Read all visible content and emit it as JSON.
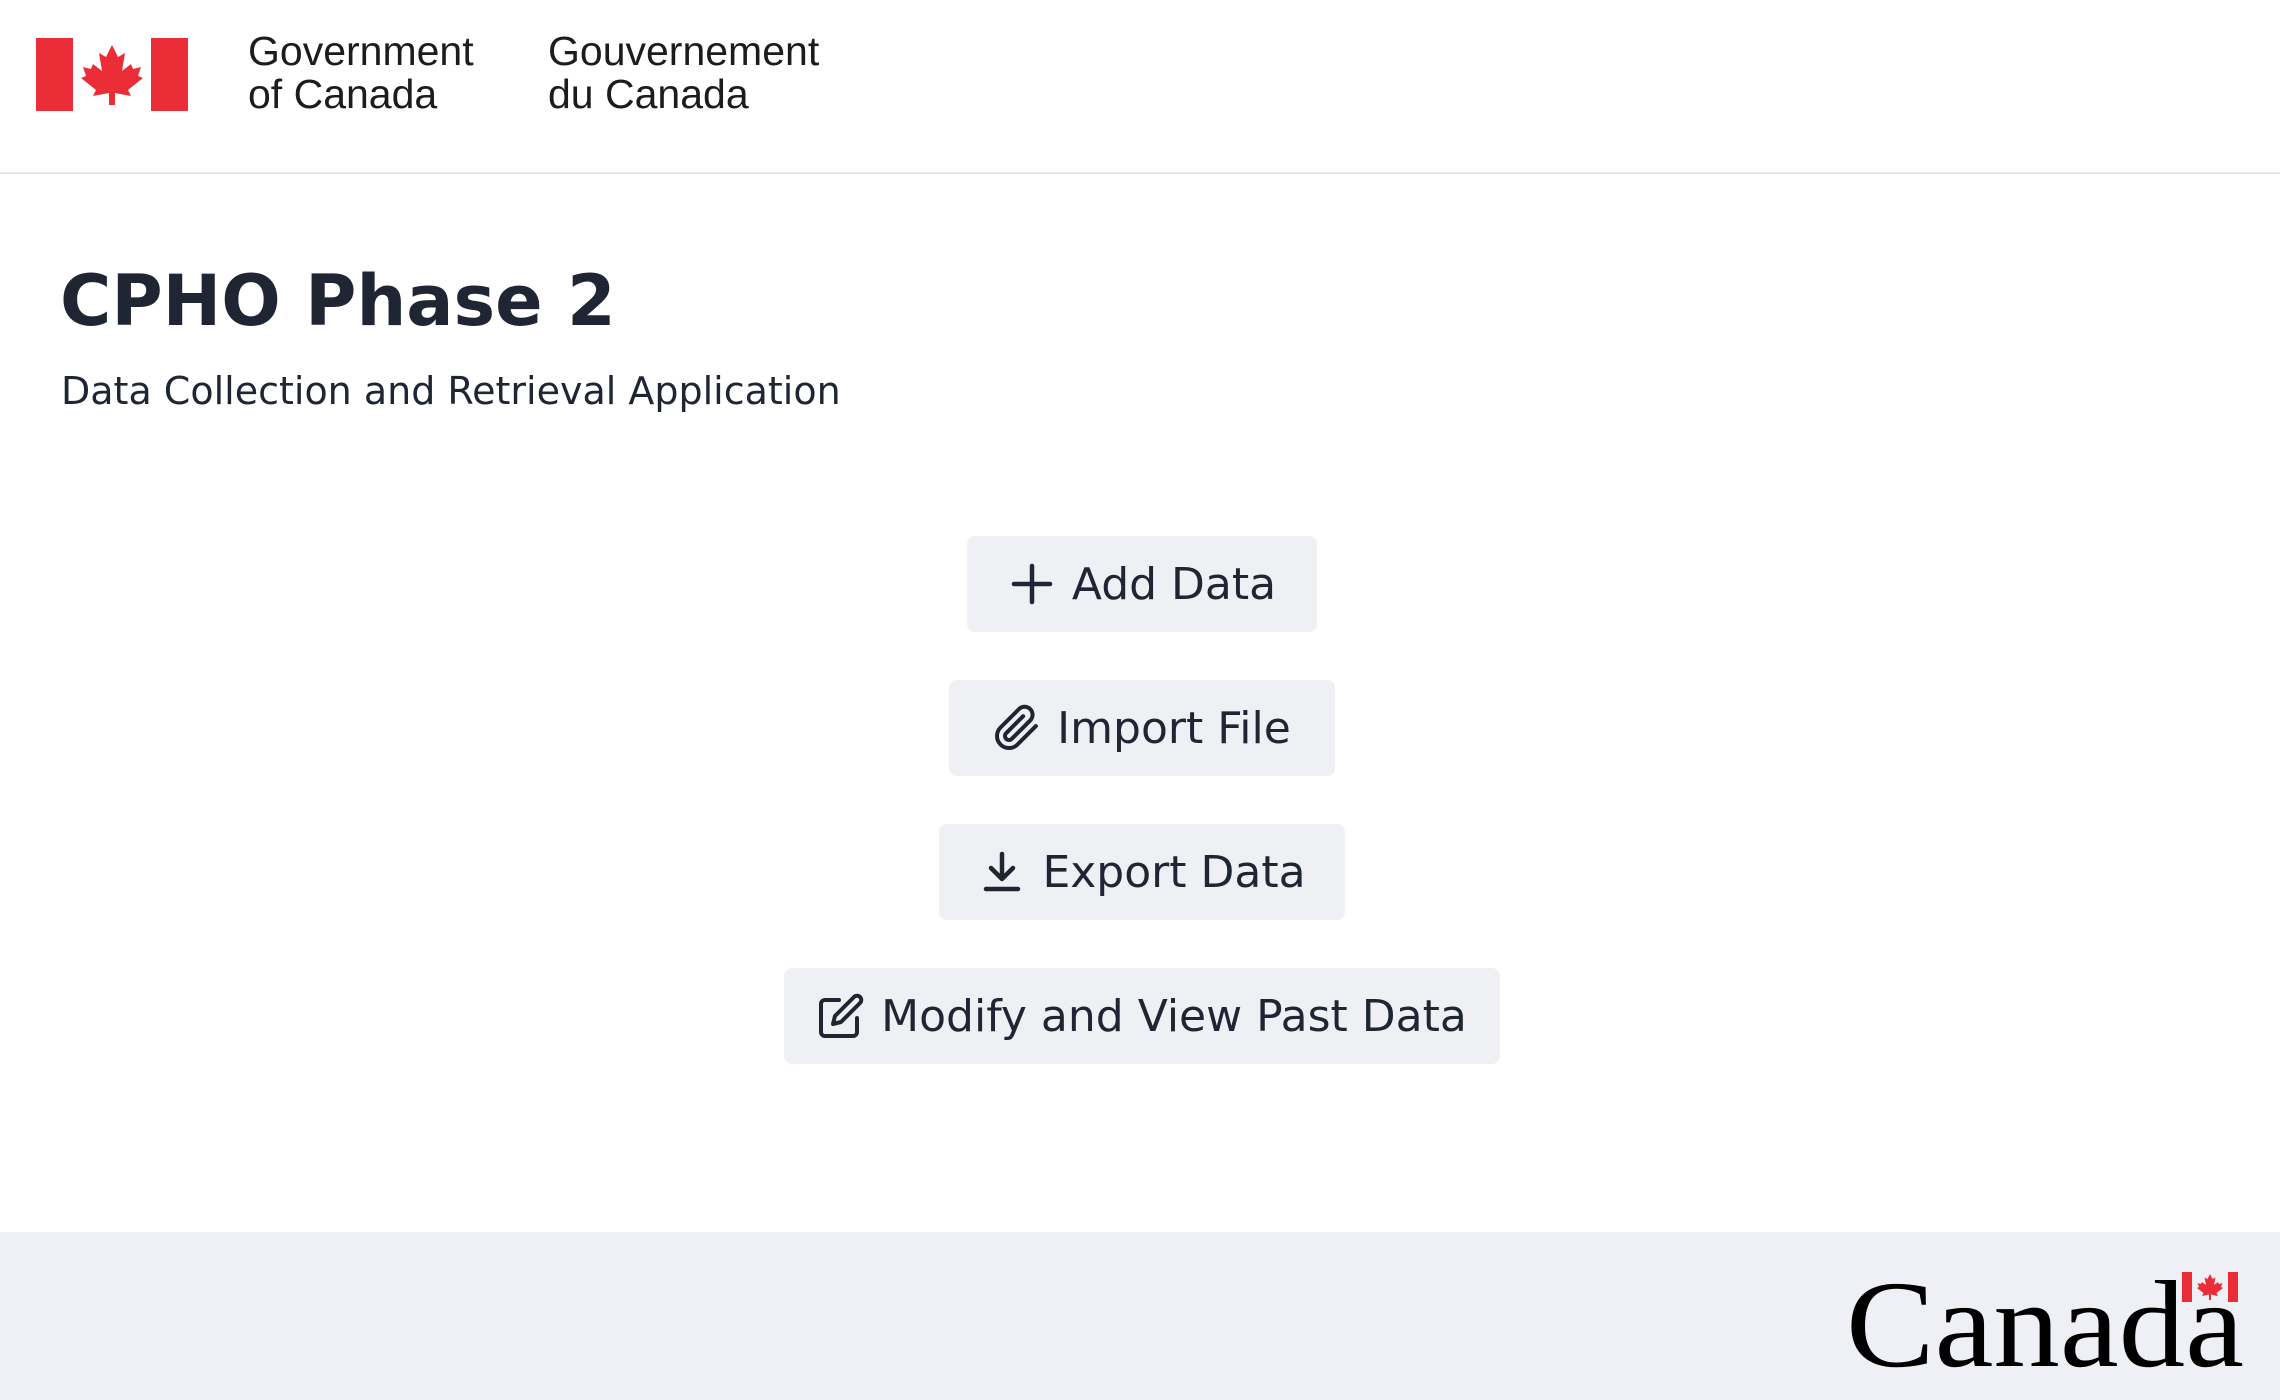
{
  "header": {
    "government_en_line1": "Government",
    "government_en_line2": "of Canada",
    "government_fr_line1": "Gouvernement",
    "government_fr_line2": "du Canada",
    "flag_color": "#eb2d37"
  },
  "main": {
    "title": "CPHO Phase 2",
    "subtitle": "Data Collection and Retrieval Application"
  },
  "actions": [
    {
      "label": "Add Data",
      "icon": "plus-icon"
    },
    {
      "label": "Import File",
      "icon": "paperclip-icon"
    },
    {
      "label": "Export Data",
      "icon": "download-icon"
    },
    {
      "label": "Modify and View Past Data",
      "icon": "edit-icon"
    }
  ],
  "footer": {
    "wordmark": "Canada",
    "background": "#eef0f5"
  },
  "colors": {
    "text": "#1f2533",
    "button_bg": "#eef0f4",
    "flag_red": "#eb2d37"
  }
}
